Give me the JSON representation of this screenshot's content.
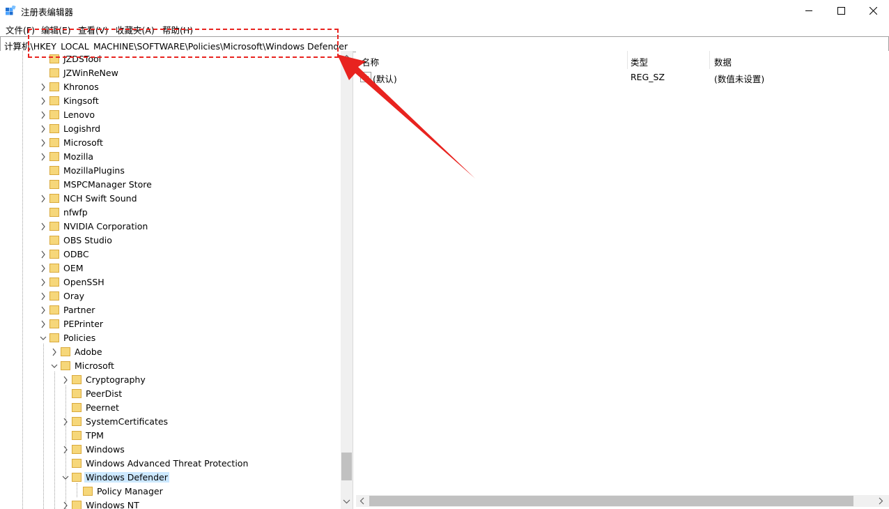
{
  "window": {
    "title": "注册表编辑器",
    "icon": "regedit-icon"
  },
  "menu": [
    {
      "label": "文件(F)"
    },
    {
      "label": "编辑(E)"
    },
    {
      "label": "查看(V)"
    },
    {
      "label": "收藏夹(A)"
    },
    {
      "label": "帮助(H)"
    }
  ],
  "address": {
    "path": "计算机\\HKEY_LOCAL_MACHINE\\SOFTWARE\\Policies\\Microsoft\\Windows Defender"
  },
  "tree": {
    "items": [
      {
        "label": "JZDSTool",
        "depth": 0,
        "expander": "none"
      },
      {
        "label": "JZWinReNew",
        "depth": 0,
        "expander": "none"
      },
      {
        "label": "Khronos",
        "depth": 0,
        "expander": "collapsed"
      },
      {
        "label": "Kingsoft",
        "depth": 0,
        "expander": "collapsed"
      },
      {
        "label": "Lenovo",
        "depth": 0,
        "expander": "collapsed"
      },
      {
        "label": "Logishrd",
        "depth": 0,
        "expander": "collapsed"
      },
      {
        "label": "Microsoft",
        "depth": 0,
        "expander": "collapsed"
      },
      {
        "label": "Mozilla",
        "depth": 0,
        "expander": "collapsed"
      },
      {
        "label": "MozillaPlugins",
        "depth": 0,
        "expander": "none"
      },
      {
        "label": "MSPCManager Store",
        "depth": 0,
        "expander": "none"
      },
      {
        "label": "NCH Swift Sound",
        "depth": 0,
        "expander": "collapsed"
      },
      {
        "label": "nfwfp",
        "depth": 0,
        "expander": "none"
      },
      {
        "label": "NVIDIA Corporation",
        "depth": 0,
        "expander": "collapsed"
      },
      {
        "label": "OBS Studio",
        "depth": 0,
        "expander": "none"
      },
      {
        "label": "ODBC",
        "depth": 0,
        "expander": "collapsed"
      },
      {
        "label": "OEM",
        "depth": 0,
        "expander": "collapsed"
      },
      {
        "label": "OpenSSH",
        "depth": 0,
        "expander": "collapsed"
      },
      {
        "label": "Oray",
        "depth": 0,
        "expander": "collapsed"
      },
      {
        "label": "Partner",
        "depth": 0,
        "expander": "collapsed"
      },
      {
        "label": "PEPrinter",
        "depth": 0,
        "expander": "collapsed"
      },
      {
        "label": "Policies",
        "depth": 0,
        "expander": "expanded"
      },
      {
        "label": "Adobe",
        "depth": 1,
        "expander": "collapsed"
      },
      {
        "label": "Microsoft",
        "depth": 1,
        "expander": "expanded"
      },
      {
        "label": "Cryptography",
        "depth": 2,
        "expander": "collapsed"
      },
      {
        "label": "PeerDist",
        "depth": 2,
        "expander": "none"
      },
      {
        "label": "Peernet",
        "depth": 2,
        "expander": "none"
      },
      {
        "label": "SystemCertificates",
        "depth": 2,
        "expander": "collapsed"
      },
      {
        "label": "TPM",
        "depth": 2,
        "expander": "none"
      },
      {
        "label": "Windows",
        "depth": 2,
        "expander": "collapsed"
      },
      {
        "label": "Windows Advanced Threat Protection",
        "depth": 2,
        "expander": "none"
      },
      {
        "label": "Windows Defender",
        "depth": 2,
        "expander": "expanded",
        "selected": true
      },
      {
        "label": "Policy Manager",
        "depth": 3,
        "expander": "none"
      },
      {
        "label": "Windows NT",
        "depth": 2,
        "expander": "collapsed"
      }
    ]
  },
  "list": {
    "columns": [
      {
        "label": "名称"
      },
      {
        "label": "类型"
      },
      {
        "label": "数据"
      }
    ],
    "rows": [
      {
        "name": "(默认)",
        "type": "REG_SZ",
        "data": "(数值未设置)",
        "icon": "string-value-icon"
      }
    ]
  },
  "colors": {
    "annotation": "#e8231f",
    "selection": "#cce8ff",
    "folder": "#f6d77a"
  }
}
